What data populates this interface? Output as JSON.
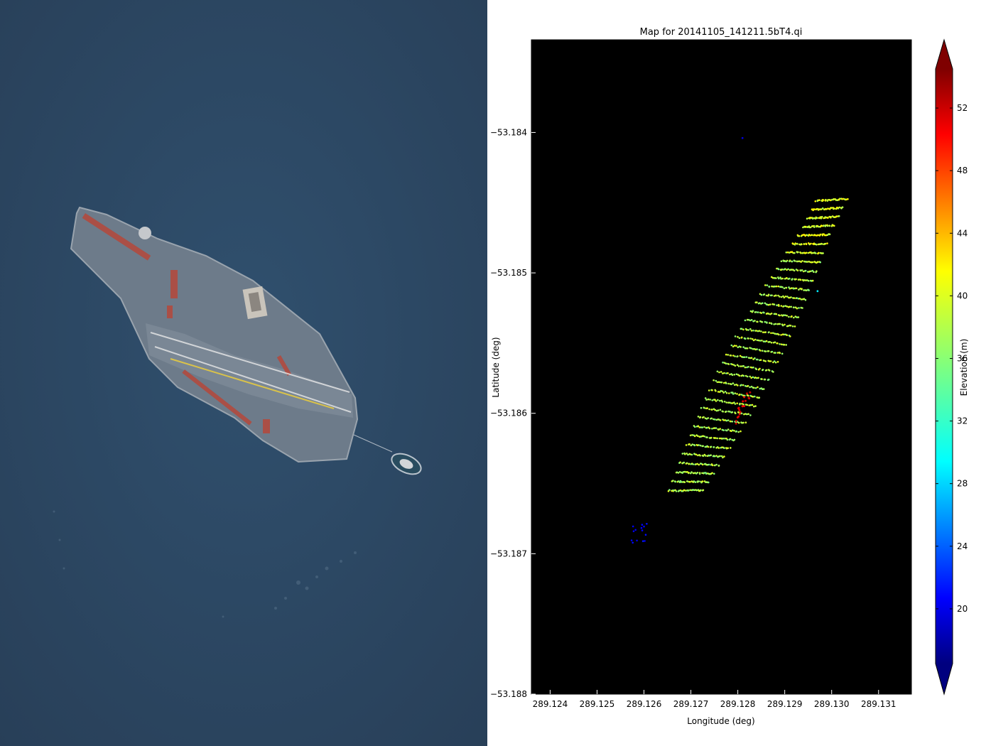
{
  "photo": {
    "subject": "aerial-photo-aircraft-carrier-with-tug",
    "colors": {
      "sea": "#2e4b68",
      "deck": "#6f7f90",
      "deck_markings": "#b5473a"
    }
  },
  "chart_data": {
    "type": "scatter",
    "title": "Map for 20141105_141211.5bT4.qi",
    "xlabel": "Longitude (deg)",
    "ylabel": "Latitude (deg)",
    "xlim": [
      289.1236,
      289.1317
    ],
    "ylim": [
      -53.188,
      -53.18334
    ],
    "xticks": [
      "289.124",
      "289.125",
      "289.126",
      "289.127",
      "289.128",
      "289.129",
      "289.130",
      "289.131"
    ],
    "yticks": [
      "-53.184",
      "-53.185",
      "-53.186",
      "-53.187",
      "-53.188"
    ],
    "xtick_values": [
      289.124,
      289.125,
      289.126,
      289.127,
      289.128,
      289.129,
      289.13,
      289.131
    ],
    "ytick_values": [
      -53.184,
      -53.185,
      -53.186,
      -53.187,
      -53.188
    ],
    "background": "#000000",
    "grid": false,
    "colorbar": {
      "label": "Elevation (m)",
      "min": 16.5,
      "max": 54.5,
      "ticks": [
        "20",
        "24",
        "28",
        "32",
        "36",
        "40",
        "44",
        "48",
        "52"
      ],
      "tick_values": [
        20,
        24,
        28,
        32,
        36,
        40,
        44,
        48,
        52
      ],
      "colormap": "jet",
      "extend": "both"
    },
    "point_clusters": [
      {
        "description": "carrier deck returns",
        "bow": [
          289.13,
          -53.18448
        ],
        "stern": [
          289.1269,
          -53.18655
        ],
        "width_deg_lon": 0.0007,
        "rows": 34,
        "points_per_row": 32,
        "elevation": 37.5
      },
      {
        "description": "superstructure returns",
        "center": [
          289.1281,
          -53.18595
        ],
        "count": 18,
        "elevation": 51
      },
      {
        "description": "tug returns",
        "center": [
          289.1259,
          -53.18685
        ],
        "count": 14,
        "elevation": 21
      },
      {
        "description": "isolated points",
        "points": [
          [
            289.1281,
            -53.18404,
            20
          ],
          [
            289.1297,
            -53.18513,
            30
          ]
        ]
      }
    ]
  }
}
